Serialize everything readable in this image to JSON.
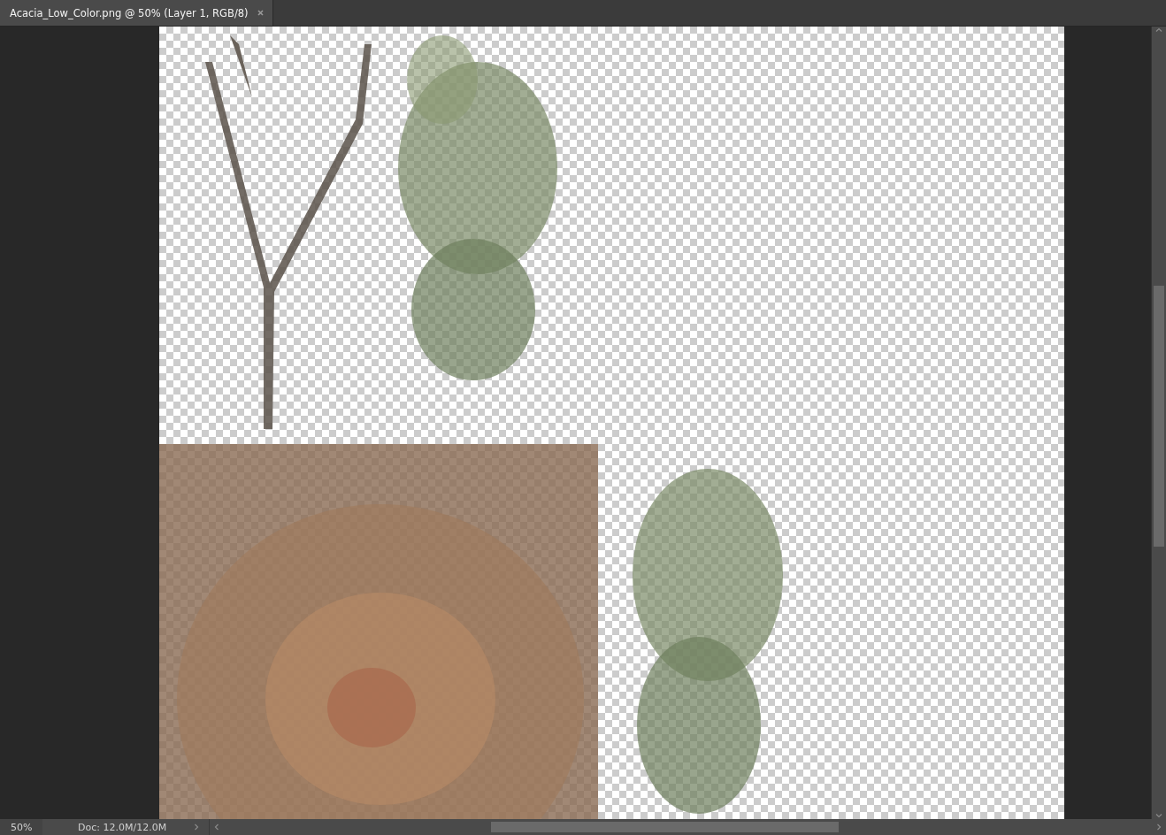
{
  "tabs": [
    {
      "label": "Acacia_Low_Color.png @ 50% (Layer 1, RGB/8)",
      "selected": true
    }
  ],
  "status_bar": {
    "zoom": "50%",
    "doc_info": "Doc: 12.0M/12.0M"
  }
}
